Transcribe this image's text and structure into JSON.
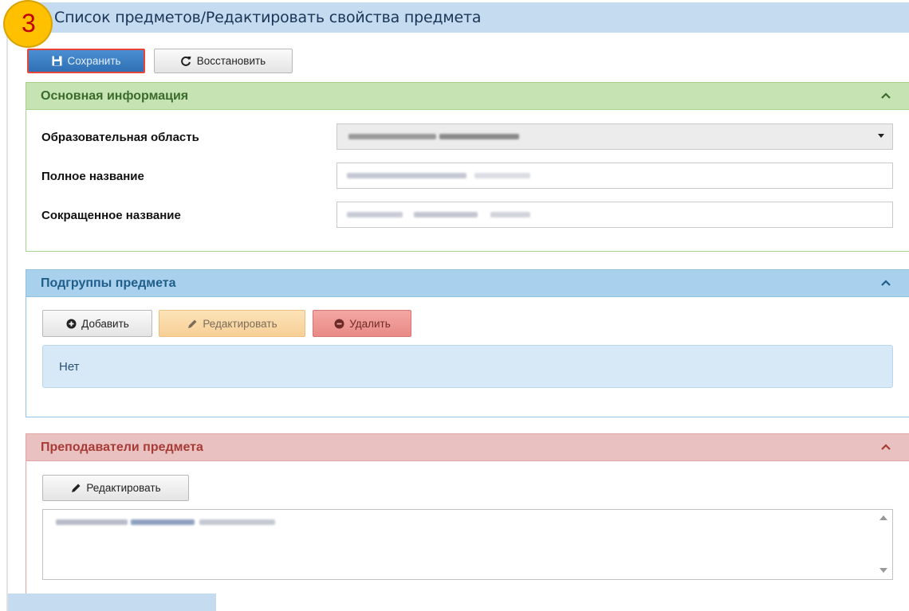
{
  "step_badge": "3",
  "page": {
    "title": "Список предметов/Редактировать свойства предмета"
  },
  "toolbar": {
    "save_label": "Сохранить",
    "restore_label": "Восстановить"
  },
  "main_info": {
    "title": "Основная информация",
    "fields": [
      {
        "label": "Образовательная область",
        "kind": "select"
      },
      {
        "label": "Полное название",
        "kind": "text"
      },
      {
        "label": "Сокращенное название",
        "kind": "text"
      }
    ]
  },
  "subgroups": {
    "title": "Подгруппы предмета",
    "add_label": "Добавить",
    "edit_label": "Редактировать",
    "delete_label": "Удалить",
    "empty_text": "Нет"
  },
  "teachers": {
    "title": "Преподаватели предмета",
    "edit_label": "Редактировать"
  },
  "colors": {
    "main_header": "#c6e3b4",
    "subgroups_header": "#a9d0ec",
    "teachers_header": "#eac1c1",
    "save_button": "#3a7ec4",
    "badge": "#ffc000"
  },
  "icons": [
    "save-icon",
    "refresh-icon",
    "chevron-up-icon",
    "plus-circle-icon",
    "pencil-icon",
    "minus-circle-icon",
    "caret-down-icon"
  ]
}
